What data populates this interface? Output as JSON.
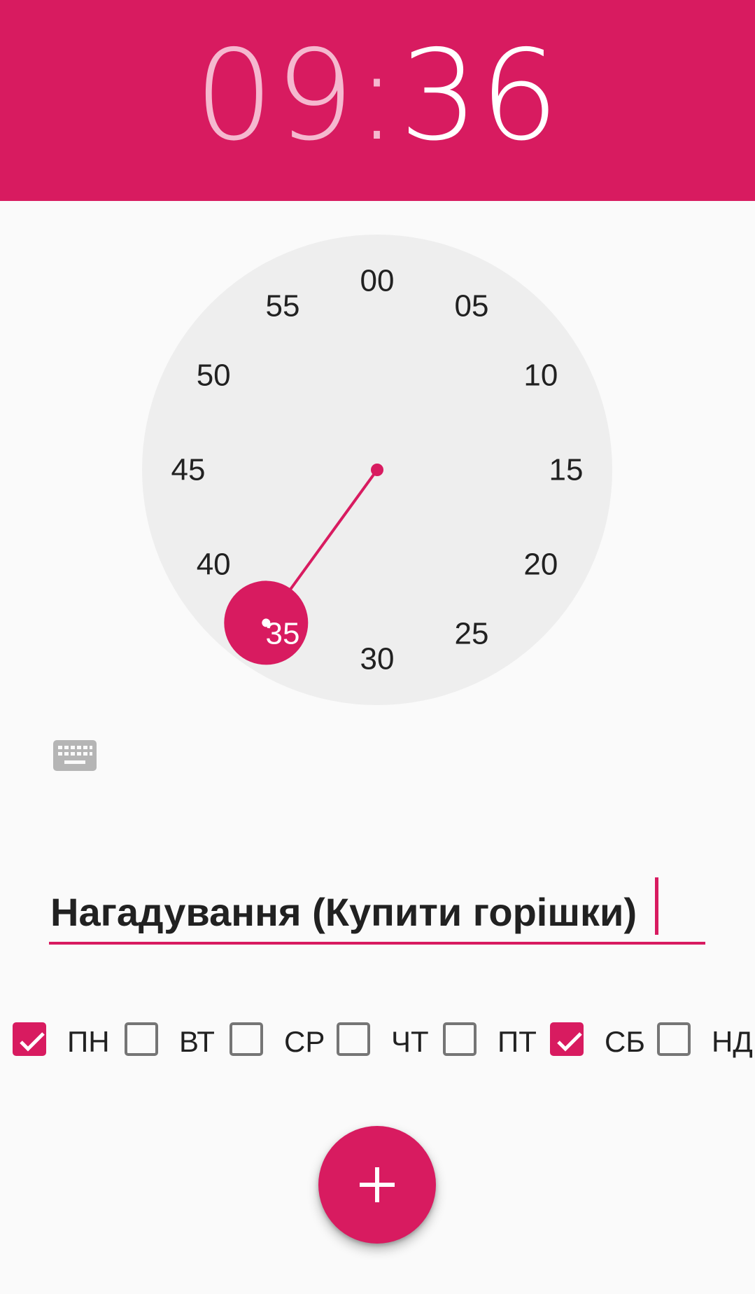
{
  "header": {
    "hours": "09",
    "separator": ":",
    "minutes": "36"
  },
  "dial": {
    "mode": "minutes",
    "selected_value": 36,
    "labels": [
      "00",
      "05",
      "10",
      "15",
      "20",
      "25",
      "30",
      "35",
      "40",
      "45",
      "50",
      "55"
    ]
  },
  "keyboard_toggle": {
    "icon": "keyboard-icon"
  },
  "reminder": {
    "title_value": "Нагадування (Купити горішки)"
  },
  "days": [
    {
      "label": "ПН",
      "checked": true
    },
    {
      "label": "ВТ",
      "checked": false
    },
    {
      "label": "СР",
      "checked": false
    },
    {
      "label": "ЧТ",
      "checked": false
    },
    {
      "label": "ПТ",
      "checked": false
    },
    {
      "label": "СБ",
      "checked": true
    },
    {
      "label": "НД",
      "checked": false
    }
  ],
  "fab": {
    "icon": "plus-icon"
  },
  "colors": {
    "accent": "#d81b60",
    "header_hours": "#f5b8cf",
    "dial_face": "#eeeeee",
    "text": "#212121"
  }
}
